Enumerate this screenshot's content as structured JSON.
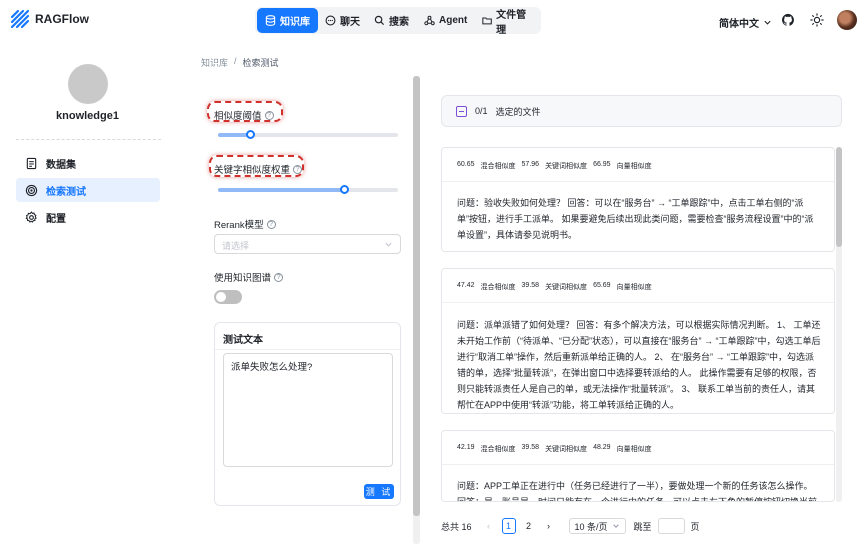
{
  "app": {
    "name": "RAGFlow",
    "brand_color": "#1677ff"
  },
  "nav": {
    "items": [
      {
        "label": "知识库",
        "icon": "database-icon",
        "active": true
      },
      {
        "label": "聊天",
        "icon": "chat-icon",
        "active": false
      },
      {
        "label": "搜索",
        "icon": "search-icon",
        "active": false
      },
      {
        "label": "Agent",
        "icon": "agent-icon",
        "active": false
      },
      {
        "label": "文件管理",
        "icon": "folder-icon",
        "active": false
      }
    ]
  },
  "header": {
    "language": "简体中文"
  },
  "breadcrumb": {
    "root": "知识库",
    "separator": "/",
    "current": "检索测试"
  },
  "sidebar": {
    "kb_name": "knowledge1",
    "items": [
      {
        "label": "数据集",
        "icon": "document-icon",
        "active": false
      },
      {
        "label": "检索测试",
        "icon": "target-icon",
        "active": true
      },
      {
        "label": "配置",
        "icon": "gear-icon",
        "active": false
      }
    ]
  },
  "settings": {
    "similarity_threshold": {
      "label": "相似度阈值",
      "value_fraction": 0.18
    },
    "keyword_weight": {
      "label": "关键字相似度权重",
      "value_fraction": 0.7
    },
    "rerank": {
      "label": "Rerank模型",
      "placeholder": "请选择"
    },
    "knowledge_graph": {
      "label": "使用知识图谱",
      "enabled": false
    },
    "test_text": {
      "title": "测试文本",
      "value": "派单失败怎么处理?",
      "button_label": "测 试"
    }
  },
  "files": {
    "count": "0/1",
    "label": "选定的文件"
  },
  "results": [
    {
      "hybrid": "60.65",
      "hybrid_label": "混合相似度",
      "keyword": "57.96",
      "keyword_label": "关键词相似度",
      "vector": "66.95",
      "vector_label": "向量相似度",
      "text": "问题：验收失败如何处理？ 回答：可以在“服务台” → “工单跟踪”中，点击工单右侧的“派单”按钮，进行手工派单。 如果要避免后续出现此类问题，需要检查“服务流程设置”中的“派单设置”，具体请参见说明书。"
    },
    {
      "hybrid": "47.42",
      "hybrid_label": "混合相似度",
      "keyword": "39.58",
      "keyword_label": "关键词相似度",
      "vector": "65.69",
      "vector_label": "向量相似度",
      "text": "问题：派单派错了如何处理？ 回答：有多个解决方法，可以根据实际情况判断。 1、 工单还未开始工作前（“待派单、“已分配”状态），可以直接在“服务台” → “工单跟踪”中，勾选工单后进行“取消工单”操作，然后重新派单给正确的人。 2、 在“服务台” → “工单跟踪”中，勾选派错的单，选择“批量转派”，在弹出窗口中选择要转派给的人。 此操作需要有足够的权限，否则只能转派责任人是自己的单，或无法操作“批量转派”。 3、 联系工单当前的责任人，请其帮忙在APP中使用“转派”功能，将工单转派给正确的人。"
    },
    {
      "hybrid": "42.19",
      "hybrid_label": "混合相似度",
      "keyword": "39.58",
      "keyword_label": "关键词相似度",
      "vector": "48.29",
      "vector_label": "向量相似度",
      "text": "问题：APP工单正在进行中（任务已经进行了一半），要做处理一个新的任务该怎么操作。 回答：是，账号是一时间只能有在一个进行中的任务，可以点击左下角的暂停按钮切换当前工单"
    }
  ],
  "pagination": {
    "total_label": "总共 16",
    "pages": [
      "1",
      "2"
    ],
    "current": "1",
    "page_size": "10 条/页",
    "jump_label": "跳至",
    "page_unit": "页"
  }
}
